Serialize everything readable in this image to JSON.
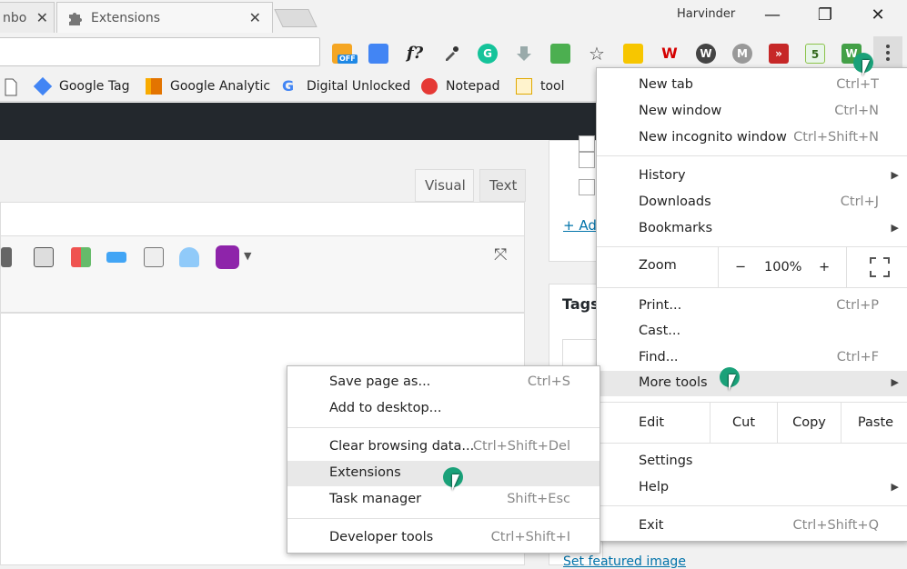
{
  "tabs": [
    {
      "label": "nbo"
    },
    {
      "label": "Extensions"
    }
  ],
  "window": {
    "user": "Harvinder",
    "minimize": "—",
    "restore": "❐",
    "close": "✕"
  },
  "toolbar": {
    "extension_off_badge": "OFF",
    "func_ext": "f?"
  },
  "bookmarks": [
    {
      "label": "Google Tag"
    },
    {
      "label": "Google Analytic"
    },
    {
      "label": "Digital Unlocked"
    },
    {
      "label": "Notepad"
    },
    {
      "label": "tool"
    }
  ],
  "editor": {
    "tab_visual": "Visual",
    "tab_text": "Text"
  },
  "sidebar": {
    "add_link": "+ Ad",
    "tags_label": "Tags",
    "featured_link": "Set featured image"
  },
  "main_menu": {
    "new_tab": {
      "label": "New tab",
      "shortcut": "Ctrl+T"
    },
    "new_window": {
      "label": "New window",
      "shortcut": "Ctrl+N"
    },
    "new_incognito": {
      "label": "New incognito window",
      "shortcut": "Ctrl+Shift+N"
    },
    "history": {
      "label": "History"
    },
    "downloads": {
      "label": "Downloads",
      "shortcut": "Ctrl+J"
    },
    "bookmarks": {
      "label": "Bookmarks"
    },
    "zoom": {
      "label": "Zoom",
      "minus": "−",
      "value": "100%",
      "plus": "+"
    },
    "print": {
      "label": "Print...",
      "shortcut": "Ctrl+P"
    },
    "cast": {
      "label": "Cast..."
    },
    "find": {
      "label": "Find...",
      "shortcut": "Ctrl+F"
    },
    "more_tools": {
      "label": "More tools"
    },
    "edit": {
      "label": "Edit",
      "cut": "Cut",
      "copy": "Copy",
      "paste": "Paste"
    },
    "settings": {
      "label": "Settings"
    },
    "help": {
      "label": "Help"
    },
    "exit": {
      "label": "Exit",
      "shortcut": "Ctrl+Shift+Q"
    }
  },
  "sub_menu": {
    "save_page": {
      "label": "Save page as...",
      "shortcut": "Ctrl+S"
    },
    "add_desktop": {
      "label": "Add to desktop..."
    },
    "clear_data": {
      "label": "Clear browsing data...",
      "shortcut": "Ctrl+Shift+Del"
    },
    "extensions": {
      "label": "Extensions"
    },
    "task_manager": {
      "label": "Task manager",
      "shortcut": "Shift+Esc"
    },
    "dev_tools": {
      "label": "Developer tools",
      "shortcut": "Ctrl+Shift+I"
    }
  }
}
